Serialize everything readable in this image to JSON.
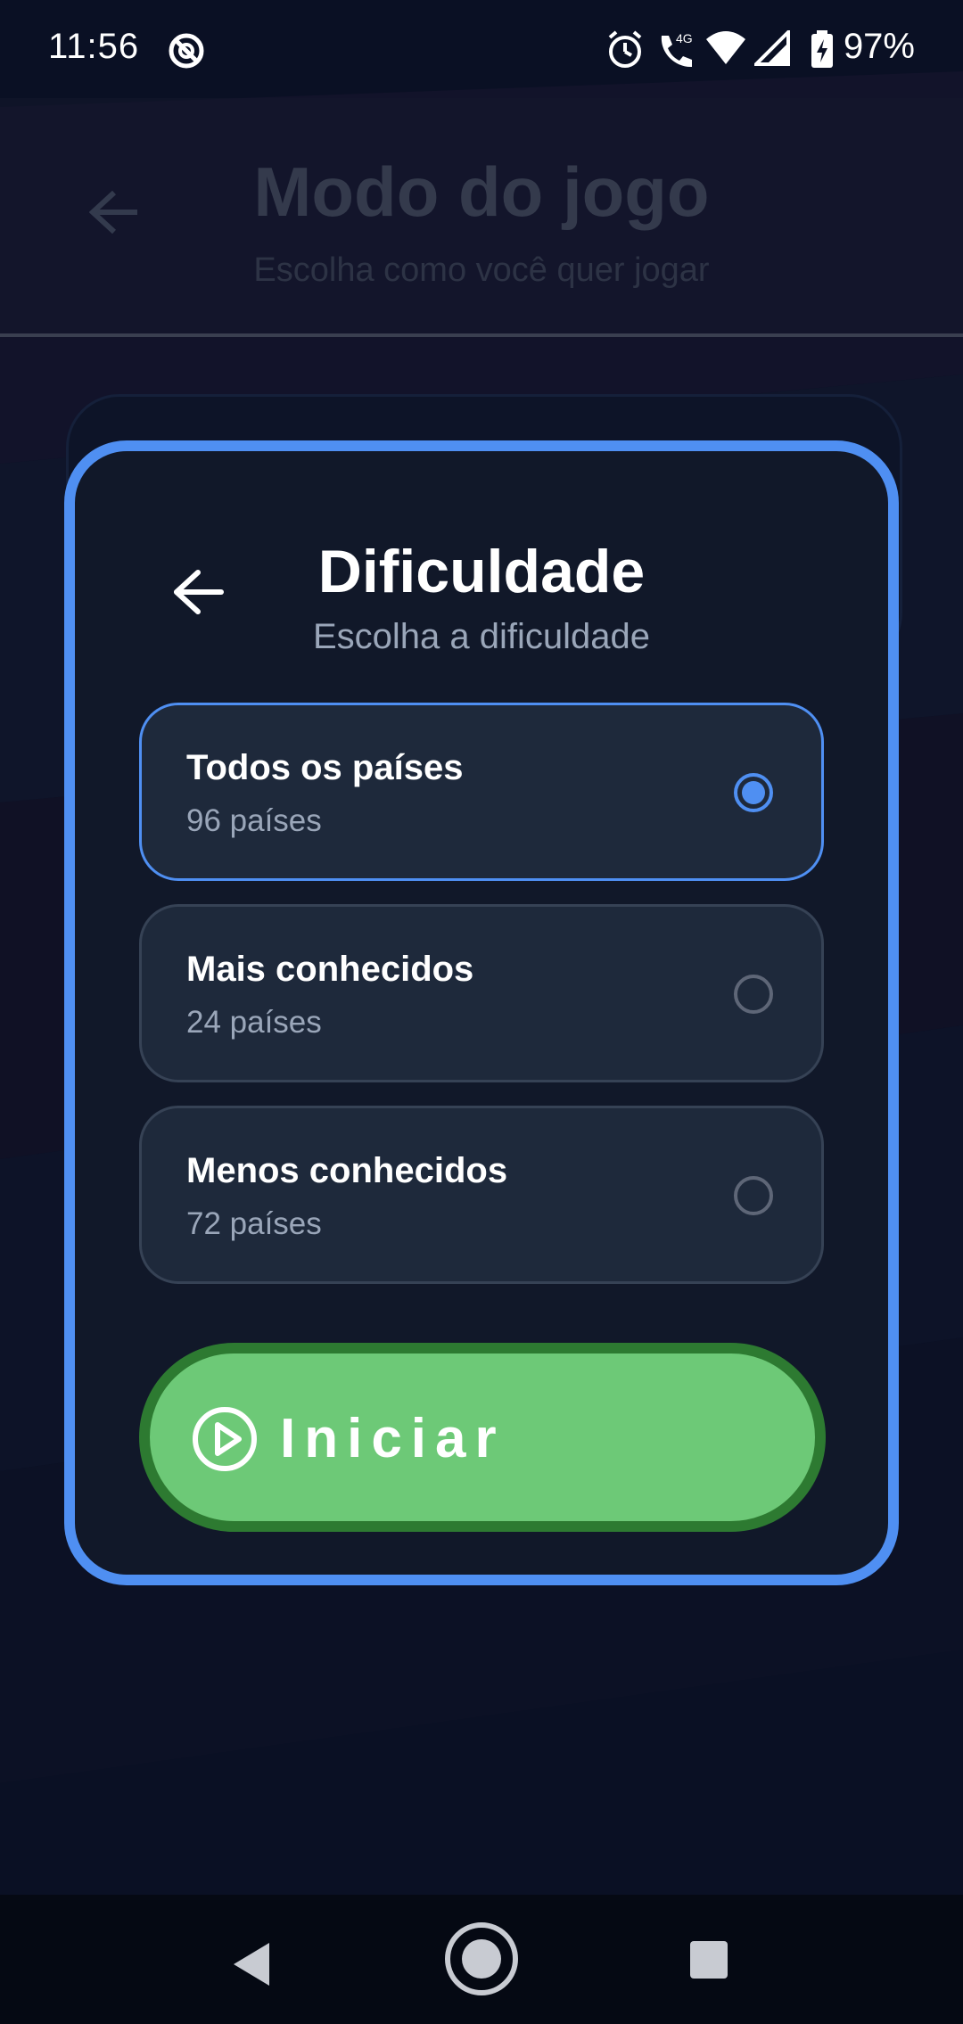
{
  "status_bar": {
    "time": "11:56",
    "battery": "97%",
    "network_label": "4G",
    "icons": [
      "sync-icon",
      "alarm-icon",
      "wifi-call-icon",
      "wifi-icon",
      "signal-icon",
      "battery-charging-icon"
    ]
  },
  "background_screen": {
    "title": "Modo do jogo",
    "subtitle": "Escolha como você quer jogar",
    "back_icon": "arrow-left-icon"
  },
  "dialog": {
    "title": "Dificuldade",
    "subtitle": "Escolha a dificuldade",
    "back_icon": "arrow-left-icon",
    "options": [
      {
        "label": "Todos os países",
        "count": "96 países",
        "selected": true
      },
      {
        "label": "Mais conhecidos",
        "count": "24 países",
        "selected": false
      },
      {
        "label": "Menos conhecidos",
        "count": "72 países",
        "selected": false
      }
    ],
    "start_button": {
      "label": "Iniciar",
      "icon": "play-circle-icon"
    }
  },
  "nav_bar": {
    "icons": [
      "back-triangle-icon",
      "home-circle-icon",
      "recents-square-icon"
    ]
  },
  "colors": {
    "accent": "#4f8ff2",
    "start_green": "#6dc977",
    "start_border": "#2d7a31",
    "dialog_bg": "#111829",
    "option_bg": "#1e293b"
  }
}
